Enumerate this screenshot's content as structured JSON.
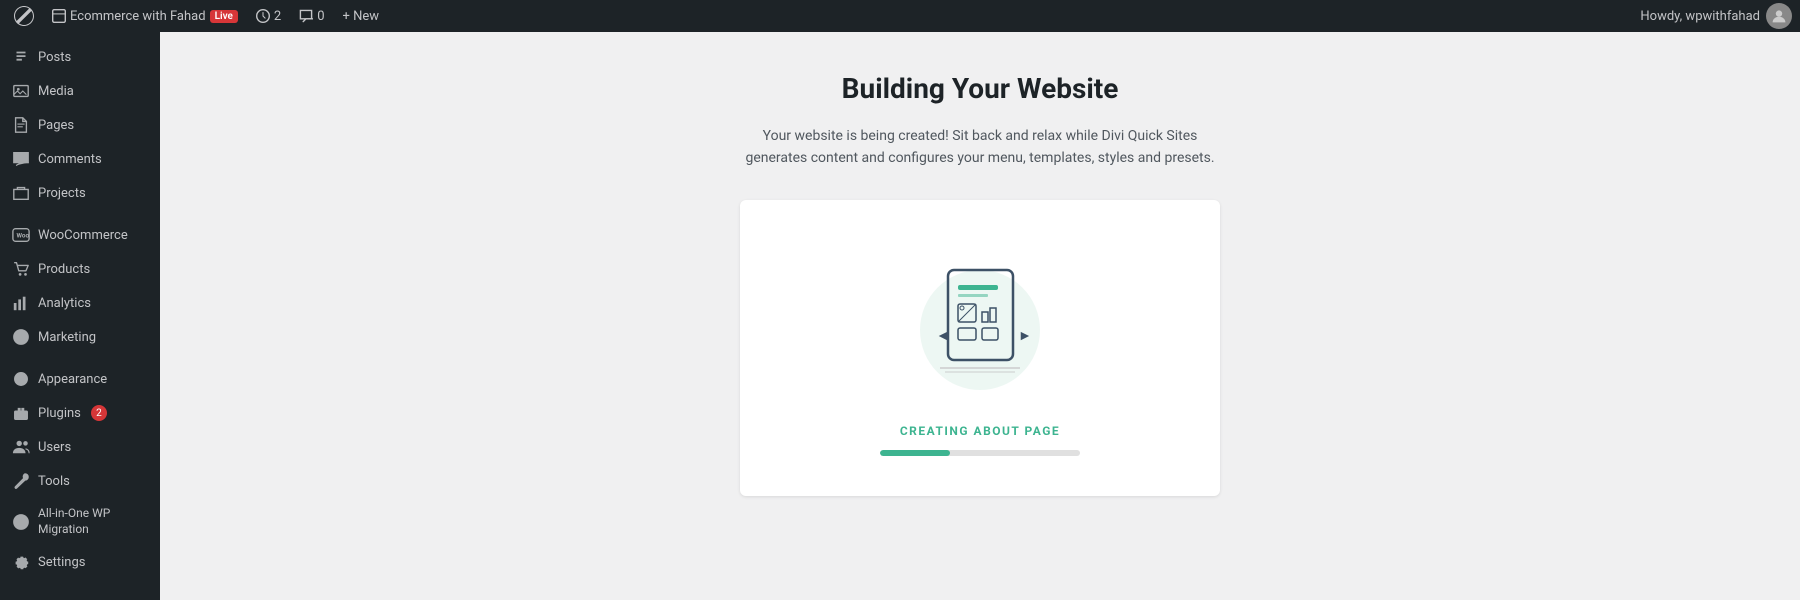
{
  "admin_bar": {
    "site_name": "Ecommerce with Fahad",
    "live_badge": "Live",
    "updates_count": "2",
    "comments_count": "0",
    "new_label": "+ New",
    "howdy_text": "Howdy, wpwithfahad"
  },
  "sidebar": {
    "items": [
      {
        "id": "posts",
        "label": "Posts",
        "icon": "posts"
      },
      {
        "id": "media",
        "label": "Media",
        "icon": "media"
      },
      {
        "id": "pages",
        "label": "Pages",
        "icon": "pages"
      },
      {
        "id": "comments",
        "label": "Comments",
        "icon": "comments"
      },
      {
        "id": "projects",
        "label": "Projects",
        "icon": "projects"
      },
      {
        "id": "woocommerce",
        "label": "WooCommerce",
        "icon": "woocommerce"
      },
      {
        "id": "products",
        "label": "Products",
        "icon": "products"
      },
      {
        "id": "analytics",
        "label": "Analytics",
        "icon": "analytics"
      },
      {
        "id": "marketing",
        "label": "Marketing",
        "icon": "marketing"
      },
      {
        "id": "appearance",
        "label": "Appearance",
        "icon": "appearance"
      },
      {
        "id": "plugins",
        "label": "Plugins",
        "icon": "plugins",
        "badge": "2"
      },
      {
        "id": "users",
        "label": "Users",
        "icon": "users"
      },
      {
        "id": "tools",
        "label": "Tools",
        "icon": "tools"
      },
      {
        "id": "all-in-one",
        "label": "All-in-One WP Migration",
        "icon": "migration"
      },
      {
        "id": "settings",
        "label": "Settings",
        "icon": "settings"
      }
    ]
  },
  "main": {
    "title": "Building Your Website",
    "subtitle": "Your website is being created! Sit back and relax while Divi Quick Sites generates content and configures your menu, templates, styles and presets.",
    "status_text": "CREATING ABOUT PAGE",
    "progress_percent": 35
  }
}
